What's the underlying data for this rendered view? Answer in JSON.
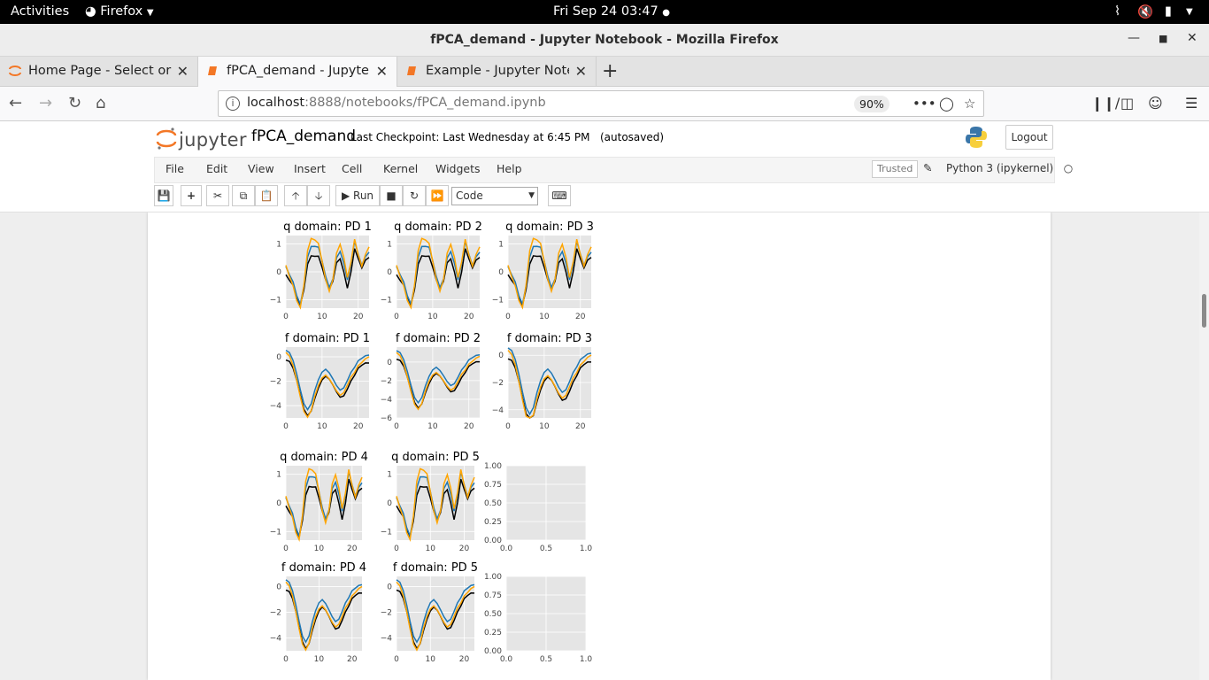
{
  "gnome": {
    "activities": "Activities",
    "app": "Firefox",
    "clock": "Fri Sep 24  03:47"
  },
  "window": {
    "title": "fPCA_demand - Jupyter Notebook - Mozilla Firefox"
  },
  "tabs": [
    {
      "label": "Home Page - Select or cr",
      "icon": "jupyter-tab-icon"
    },
    {
      "label": "fPCA_demand - Jupyter N",
      "icon": "jupyter-tab-icon"
    },
    {
      "label": "Example - Jupyter Notebo",
      "icon": "jupyter-tab-icon"
    }
  ],
  "urlbar": {
    "host": "localhost",
    "rest": ":8888/notebooks/fPCA_demand.ipynb",
    "zoom": "90%"
  },
  "jupyter": {
    "logo_text": "jupyter",
    "notebook_name": "fPCA_demand",
    "checkpoint": "Last Checkpoint: Last Wednesday at 6:45 PM",
    "autosaved": "(autosaved)",
    "logout": "Logout",
    "menu": [
      "File",
      "Edit",
      "View",
      "Insert",
      "Cell",
      "Kernel",
      "Widgets",
      "Help"
    ],
    "trusted": "Trusted",
    "kernel": "Python 3 (ipykernel)",
    "run_label": "Run",
    "cell_type": "Code"
  },
  "colors": {
    "black": "#000000",
    "blue": "#1f77b4",
    "orange": "#ffa500",
    "axes_bg": "#e5e5e5",
    "grid": "#ffffff"
  },
  "chart_data": [
    {
      "type": "line",
      "title": "q domain: PD 1",
      "xticks": [
        "0",
        "10",
        "20"
      ],
      "yticks": [
        "1",
        "0",
        "−1"
      ],
      "xlim": [
        0,
        23
      ],
      "ylim": [
        -1.3,
        1.3
      ]
    },
    {
      "type": "line",
      "title": "q domain: PD 2",
      "xticks": [
        "0",
        "10",
        "20"
      ],
      "yticks": [
        "1",
        "0",
        "−1"
      ],
      "xlim": [
        0,
        23
      ],
      "ylim": [
        -1.3,
        1.3
      ]
    },
    {
      "type": "line",
      "title": "q domain: PD 3",
      "xticks": [
        "0",
        "10",
        "20"
      ],
      "yticks": [
        "1",
        "0",
        "−1"
      ],
      "xlim": [
        0,
        23
      ],
      "ylim": [
        -1.3,
        1.3
      ]
    },
    {
      "type": "line",
      "title": "f domain: PD 1",
      "xticks": [
        "0",
        "10",
        "20"
      ],
      "yticks": [
        "0",
        "−2",
        "−4"
      ],
      "xlim": [
        0,
        23
      ],
      "ylim": [
        -5,
        0.8
      ]
    },
    {
      "type": "line",
      "title": "f domain: PD 2",
      "xticks": [
        "0",
        "10",
        "20"
      ],
      "yticks": [
        "0",
        "−2",
        "−4",
        "−6"
      ],
      "xlim": [
        0,
        23
      ],
      "ylim": [
        -6,
        1.6
      ]
    },
    {
      "type": "line",
      "title": "f domain: PD 3",
      "xticks": [
        "0",
        "10",
        "20"
      ],
      "yticks": [
        "0",
        "−2",
        "−4"
      ],
      "xlim": [
        0,
        23
      ],
      "ylim": [
        -4.6,
        0.6
      ]
    },
    {
      "type": "line",
      "title": "q domain: PD 4",
      "xticks": [
        "0",
        "10",
        "20"
      ],
      "yticks": [
        "1",
        "0",
        "−1"
      ],
      "xlim": [
        0,
        23
      ],
      "ylim": [
        -1.3,
        1.3
      ]
    },
    {
      "type": "line",
      "title": "q domain: PD 5",
      "xticks": [
        "0",
        "10",
        "20"
      ],
      "yticks": [
        "1",
        "0",
        "−1"
      ],
      "xlim": [
        0,
        23
      ],
      "ylim": [
        -1.3,
        1.3
      ]
    },
    {
      "type": "empty",
      "title": "",
      "xticks": [
        "0.0",
        "0.5",
        "1.0"
      ],
      "yticks": [
        "1.00",
        "0.75",
        "0.50",
        "0.25",
        "0.00"
      ],
      "xlim": [
        0,
        1
      ],
      "ylim": [
        0,
        1
      ]
    },
    {
      "type": "line",
      "title": "f domain: PD 4",
      "xticks": [
        "0",
        "10",
        "20"
      ],
      "yticks": [
        "0",
        "−2",
        "−4"
      ],
      "xlim": [
        0,
        23
      ],
      "ylim": [
        -5,
        0.8
      ]
    },
    {
      "type": "line",
      "title": "f domain: PD 5",
      "xticks": [
        "0",
        "10",
        "20"
      ],
      "yticks": [
        "0",
        "−2",
        "−4"
      ],
      "xlim": [
        0,
        23
      ],
      "ylim": [
        -5,
        0.8
      ]
    },
    {
      "type": "empty",
      "title": "",
      "xticks": [
        "0.0",
        "0.5",
        "1.0"
      ],
      "yticks": [
        "1.00",
        "0.75",
        "0.50",
        "0.25",
        "0.00"
      ],
      "xlim": [
        0,
        1
      ],
      "ylim": [
        0,
        1
      ]
    }
  ]
}
